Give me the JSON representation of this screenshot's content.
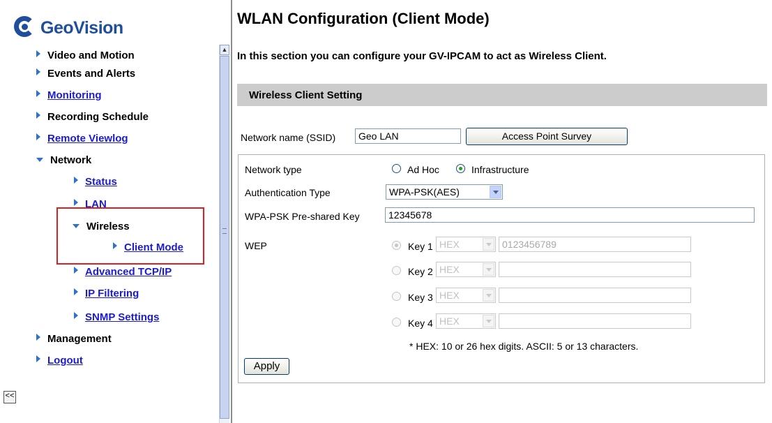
{
  "brand": {
    "name": "GeoVision",
    "color": "#1f4e9e"
  },
  "colors": {
    "link": "#1b1bd6",
    "highlight": "#e02020",
    "section_bg": "#cccccc"
  },
  "nav": {
    "video_and_motion": "Video and Motion",
    "events_and_alerts": "Events and Alerts",
    "monitoring": "Monitoring",
    "recording_schedule": "Recording Schedule",
    "remote_viewlog": "Remote Viewlog",
    "network": "Network",
    "status": "Status",
    "lan": "LAN",
    "wireless": "Wireless",
    "client_mode": "Client Mode",
    "advanced_tcpip": "Advanced TCP/IP",
    "ip_filtering": "IP Filtering",
    "snmp_settings": "SNMP Settings",
    "management": "Management",
    "logout": "Logout",
    "collapse_label": "<<"
  },
  "page": {
    "title": "WLAN Configuration (Client Mode)",
    "intro": "In this section you can configure your GV-IPCAM to act as Wireless Client.",
    "section_title": "Wireless Client Setting"
  },
  "form": {
    "ssid_label": "Network name (SSID)",
    "ssid_value": "Geo LAN",
    "survey_button": "Access Point Survey",
    "network_type_label": "Network type",
    "adhoc_label": "Ad Hoc",
    "infrastructure_label": "Infrastructure",
    "auth_label": "Authentication Type",
    "auth_value": "WPA-PSK(AES)",
    "psk_label": "WPA-PSK Pre-shared Key",
    "psk_value": "12345678",
    "wep_label": "WEP",
    "keys": [
      {
        "label": "Key 1",
        "format": "HEX",
        "value": "0123456789"
      },
      {
        "label": "Key 2",
        "format": "HEX",
        "value": ""
      },
      {
        "label": "Key 3",
        "format": "HEX",
        "value": ""
      },
      {
        "label": "Key 4",
        "format": "HEX",
        "value": ""
      }
    ],
    "note": "* HEX: 10 or 26 hex digits. ASCII: 5 or 13 characters.",
    "apply_button": "Apply"
  }
}
